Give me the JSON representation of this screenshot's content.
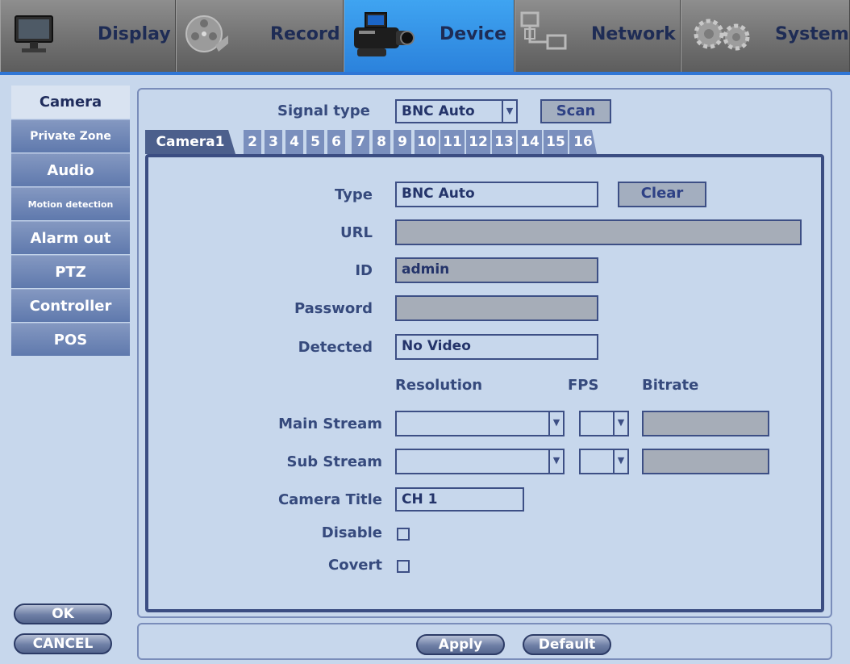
{
  "menu": {
    "tabs": [
      {
        "label": "Display",
        "icon": "monitor-icon"
      },
      {
        "label": "Record",
        "icon": "film-reel-icon"
      },
      {
        "label": "Device",
        "icon": "camcorder-icon"
      },
      {
        "label": "Network",
        "icon": "network-icon"
      },
      {
        "label": "System",
        "icon": "gears-icon"
      }
    ],
    "active": "Device",
    "accent_color": "#2f76d6"
  },
  "sidebar": {
    "items": [
      {
        "label": "Camera"
      },
      {
        "label": "Private Zone"
      },
      {
        "label": "Audio"
      },
      {
        "label": "Motion detection"
      },
      {
        "label": "Alarm out"
      },
      {
        "label": "PTZ"
      },
      {
        "label": "Controller"
      },
      {
        "label": "POS"
      }
    ],
    "active": "Camera",
    "ok_label": "OK",
    "cancel_label": "CANCEL"
  },
  "signal": {
    "label": "Signal type",
    "value": "BNC Auto",
    "scan_label": "Scan"
  },
  "camera_tabs": [
    "Camera1",
    "2",
    "3",
    "4",
    "5",
    "6",
    "7",
    "8",
    "9",
    "10",
    "11",
    "12",
    "13",
    "14",
    "15",
    "16"
  ],
  "form": {
    "type_label": "Type",
    "type_value": "BNC Auto",
    "clear_label": "Clear",
    "url_label": "URL",
    "url_value": "",
    "id_label": "ID",
    "id_value": "admin",
    "password_label": "Password",
    "password_value": "",
    "detected_label": "Detected",
    "detected_value": "No Video",
    "col_resolution": "Resolution",
    "col_fps": "FPS",
    "col_bitrate": "Bitrate",
    "main_stream_label": "Main Stream",
    "sub_stream_label": "Sub Stream",
    "camera_title_label": "Camera Title",
    "camera_title_value": "CH 1",
    "disable_label": "Disable",
    "covert_label": "Covert"
  },
  "footer": {
    "apply_label": "Apply",
    "default_label": "Default"
  }
}
